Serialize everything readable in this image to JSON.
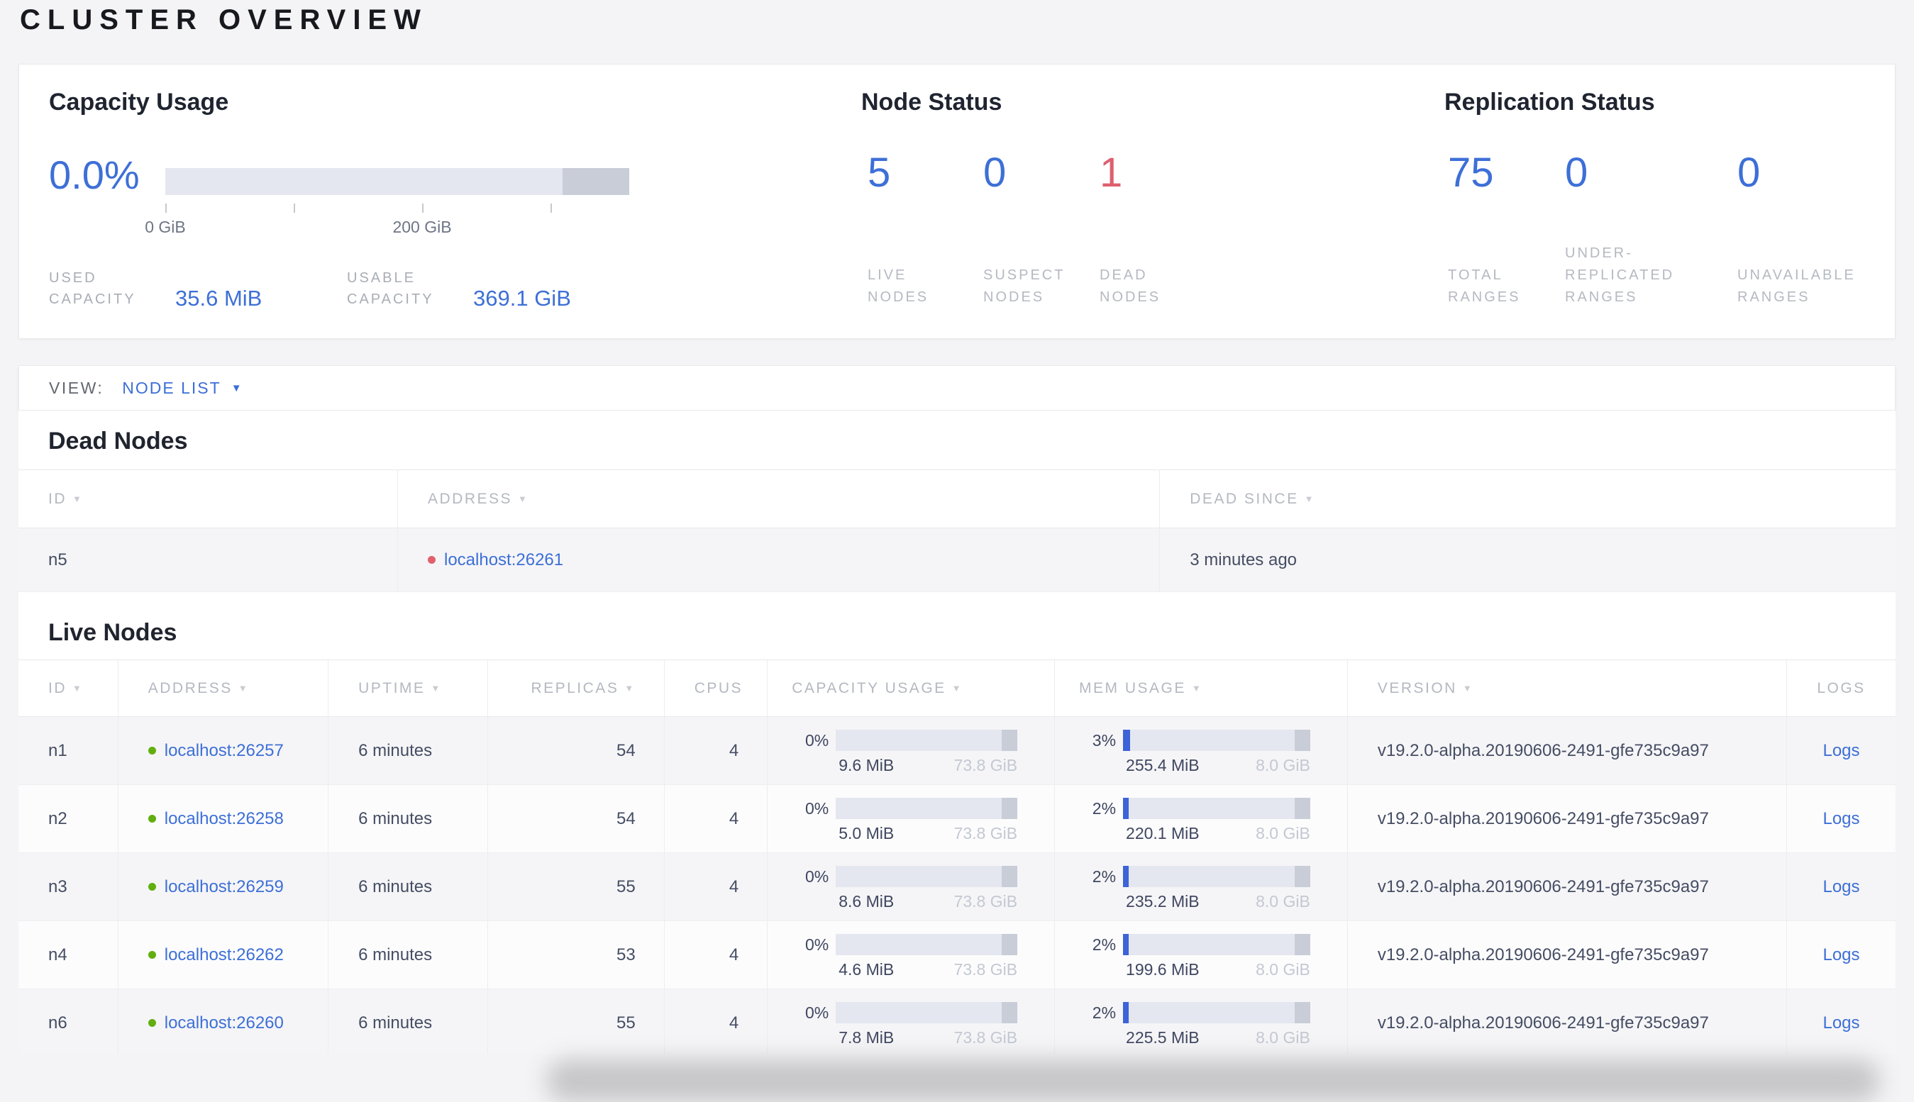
{
  "colors": {
    "accent_blue": "#3d6fd7",
    "warn_red": "#de5f6e",
    "live_dot_green": "#62ae0f",
    "dead_dot_red": "#e0606c"
  },
  "page_title": "CLUSTER OVERVIEW",
  "summary": {
    "capacity": {
      "title": "Capacity Usage",
      "percent": "0.0%",
      "tick_labels": [
        "0 GiB",
        "200 GiB"
      ],
      "stats": [
        {
          "label": "USED CAPACITY",
          "value": "35.6 MiB"
        },
        {
          "label": "USABLE CAPACITY",
          "value": "369.1 GiB"
        }
      ]
    },
    "node_status": {
      "title": "Node Status",
      "items": [
        {
          "value": "5",
          "label": "LIVE NODES",
          "tone": "blue"
        },
        {
          "value": "0",
          "label": "SUSPECT NODES",
          "tone": "blue"
        },
        {
          "value": "1",
          "label": "DEAD NODES",
          "tone": "red"
        }
      ]
    },
    "replication": {
      "title": "Replication Status",
      "items": [
        {
          "value": "75",
          "label": "TOTAL RANGES",
          "tone": "blue"
        },
        {
          "value": "0",
          "label": "UNDER-REPLICATED RANGES",
          "tone": "blue"
        },
        {
          "value": "0",
          "label": "UNAVAILABLE RANGES",
          "tone": "blue"
        }
      ]
    }
  },
  "view_bar": {
    "label": "VIEW:",
    "selected": "NODE LIST",
    "caret": "▼"
  },
  "dead_nodes": {
    "heading": "Dead Nodes",
    "columns": [
      {
        "label": "ID",
        "arrow": "▼"
      },
      {
        "label": "ADDRESS",
        "arrow": "▼"
      },
      {
        "label": "DEAD SINCE",
        "arrow": "▼"
      }
    ],
    "rows": [
      {
        "id": "n5",
        "address": "localhost:26261",
        "dead_since": "3 minutes ago"
      }
    ]
  },
  "live_nodes": {
    "heading": "Live Nodes",
    "columns": [
      {
        "label": "ID",
        "arrow": "▼"
      },
      {
        "label": "ADDRESS",
        "arrow": "▼"
      },
      {
        "label": "UPTIME",
        "arrow": "▼"
      },
      {
        "label": "REPLICAS",
        "arrow": "▼"
      },
      {
        "label": "CPUS",
        "arrow": ""
      },
      {
        "label": "CAPACITY USAGE",
        "arrow": "▼"
      },
      {
        "label": "MEM USAGE",
        "arrow": "▼"
      },
      {
        "label": "VERSION",
        "arrow": "▼"
      },
      {
        "label": "LOGS",
        "arrow": ""
      }
    ],
    "rows": [
      {
        "id": "n1",
        "address": "localhost:26257",
        "uptime": "6 minutes",
        "replicas": "54",
        "cpus": "4",
        "capacity": {
          "percent": "0%",
          "pct": 0,
          "used": "9.6 MiB",
          "total": "73.8 GiB"
        },
        "memory": {
          "percent": "3%",
          "pct": 3,
          "used": "255.4 MiB",
          "total": "8.0 GiB"
        },
        "version": "v19.2.0-alpha.20190606-2491-gfe735c9a97",
        "logs": "Logs"
      },
      {
        "id": "n2",
        "address": "localhost:26258",
        "uptime": "6 minutes",
        "replicas": "54",
        "cpus": "4",
        "capacity": {
          "percent": "0%",
          "pct": 0,
          "used": "5.0 MiB",
          "total": "73.8 GiB"
        },
        "memory": {
          "percent": "2%",
          "pct": 2,
          "used": "220.1 MiB",
          "total": "8.0 GiB"
        },
        "version": "v19.2.0-alpha.20190606-2491-gfe735c9a97",
        "logs": "Logs"
      },
      {
        "id": "n3",
        "address": "localhost:26259",
        "uptime": "6 minutes",
        "replicas": "55",
        "cpus": "4",
        "capacity": {
          "percent": "0%",
          "pct": 0,
          "used": "8.6 MiB",
          "total": "73.8 GiB"
        },
        "memory": {
          "percent": "2%",
          "pct": 2,
          "used": "235.2 MiB",
          "total": "8.0 GiB"
        },
        "version": "v19.2.0-alpha.20190606-2491-gfe735c9a97",
        "logs": "Logs"
      },
      {
        "id": "n4",
        "address": "localhost:26262",
        "uptime": "6 minutes",
        "replicas": "53",
        "cpus": "4",
        "capacity": {
          "percent": "0%",
          "pct": 0,
          "used": "4.6 MiB",
          "total": "73.8 GiB"
        },
        "memory": {
          "percent": "2%",
          "pct": 2,
          "used": "199.6 MiB",
          "total": "8.0 GiB"
        },
        "version": "v19.2.0-alpha.20190606-2491-gfe735c9a97",
        "logs": "Logs"
      },
      {
        "id": "n6",
        "address": "localhost:26260",
        "uptime": "6 minutes",
        "replicas": "55",
        "cpus": "4",
        "capacity": {
          "percent": "0%",
          "pct": 0,
          "used": "7.8 MiB",
          "total": "73.8 GiB"
        },
        "memory": {
          "percent": "2%",
          "pct": 2,
          "used": "225.5 MiB",
          "total": "8.0 GiB"
        },
        "version": "v19.2.0-alpha.20190606-2491-gfe735c9a97",
        "logs": "Logs"
      }
    ]
  }
}
